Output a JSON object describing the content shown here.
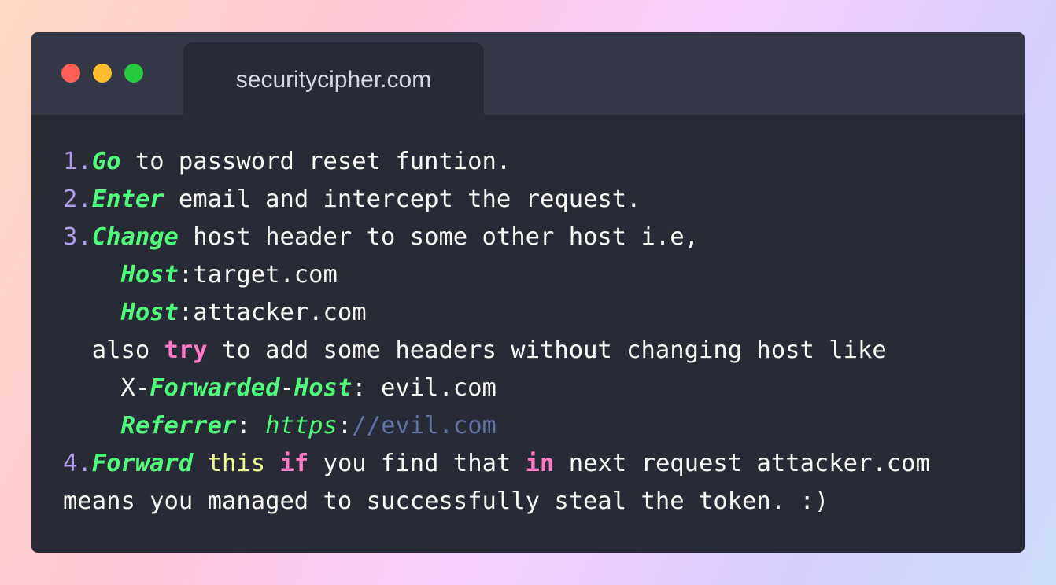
{
  "window": {
    "tab_title": "securitycipher.com",
    "controls": {
      "close_color": "#ff5f56",
      "minimize_color": "#ffbd2e",
      "maximize_color": "#27c93f"
    }
  },
  "theme": {
    "background": "#282a36",
    "titlebar": "#343746",
    "number": "#b39ce8",
    "function": "#50fa7b",
    "keyword": "#ff79c6",
    "variable": "#f1fa8c",
    "comment": "#6272a4",
    "text": "#f8f8f2"
  },
  "code_lines": [
    {
      "tokens": [
        {
          "t": "1.",
          "c": "num"
        },
        {
          "t": "Go",
          "c": "fn"
        },
        {
          "t": " to password reset funtion.",
          "c": "plain"
        }
      ]
    },
    {
      "tokens": [
        {
          "t": "2.",
          "c": "num"
        },
        {
          "t": "Enter",
          "c": "fn"
        },
        {
          "t": " email and intercept the request.",
          "c": "plain"
        }
      ]
    },
    {
      "tokens": [
        {
          "t": "3.",
          "c": "num"
        },
        {
          "t": "Change",
          "c": "fn"
        },
        {
          "t": " host header to some other host i.e,",
          "c": "plain"
        }
      ]
    },
    {
      "tokens": [
        {
          "t": "    ",
          "c": "plain"
        },
        {
          "t": "Host",
          "c": "fn"
        },
        {
          "t": ":target.com",
          "c": "plain"
        }
      ]
    },
    {
      "tokens": [
        {
          "t": "    ",
          "c": "plain"
        },
        {
          "t": "Host",
          "c": "fn"
        },
        {
          "t": ":attacker.com",
          "c": "plain"
        }
      ]
    },
    {
      "tokens": [
        {
          "t": "  also ",
          "c": "plain"
        },
        {
          "t": "try",
          "c": "kw"
        },
        {
          "t": " to add some headers without changing host like",
          "c": "plain"
        }
      ]
    },
    {
      "tokens": [
        {
          "t": "    X-",
          "c": "plain"
        },
        {
          "t": "Forwarded",
          "c": "fn"
        },
        {
          "t": "-",
          "c": "plain"
        },
        {
          "t": "Host",
          "c": "fn"
        },
        {
          "t": ": evil.com",
          "c": "plain"
        }
      ]
    },
    {
      "tokens": [
        {
          "t": "    ",
          "c": "plain"
        },
        {
          "t": "Referrer",
          "c": "fn"
        },
        {
          "t": ": ",
          "c": "plain"
        },
        {
          "t": "https",
          "c": "fn-url"
        },
        {
          "t": ":",
          "c": "plain"
        },
        {
          "t": "//evil.com",
          "c": "url"
        }
      ]
    },
    {
      "tokens": [
        {
          "t": "4.",
          "c": "num"
        },
        {
          "t": "Forward",
          "c": "fn"
        },
        {
          "t": " ",
          "c": "plain"
        },
        {
          "t": "this",
          "c": "var"
        },
        {
          "t": " ",
          "c": "plain"
        },
        {
          "t": "if",
          "c": "kw"
        },
        {
          "t": " you find that ",
          "c": "plain"
        },
        {
          "t": "in",
          "c": "kw"
        },
        {
          "t": " next request attacker.com",
          "c": "plain"
        }
      ]
    },
    {
      "tokens": [
        {
          "t": "means you managed to successfully steal the token. :)",
          "c": "plain"
        }
      ]
    }
  ]
}
